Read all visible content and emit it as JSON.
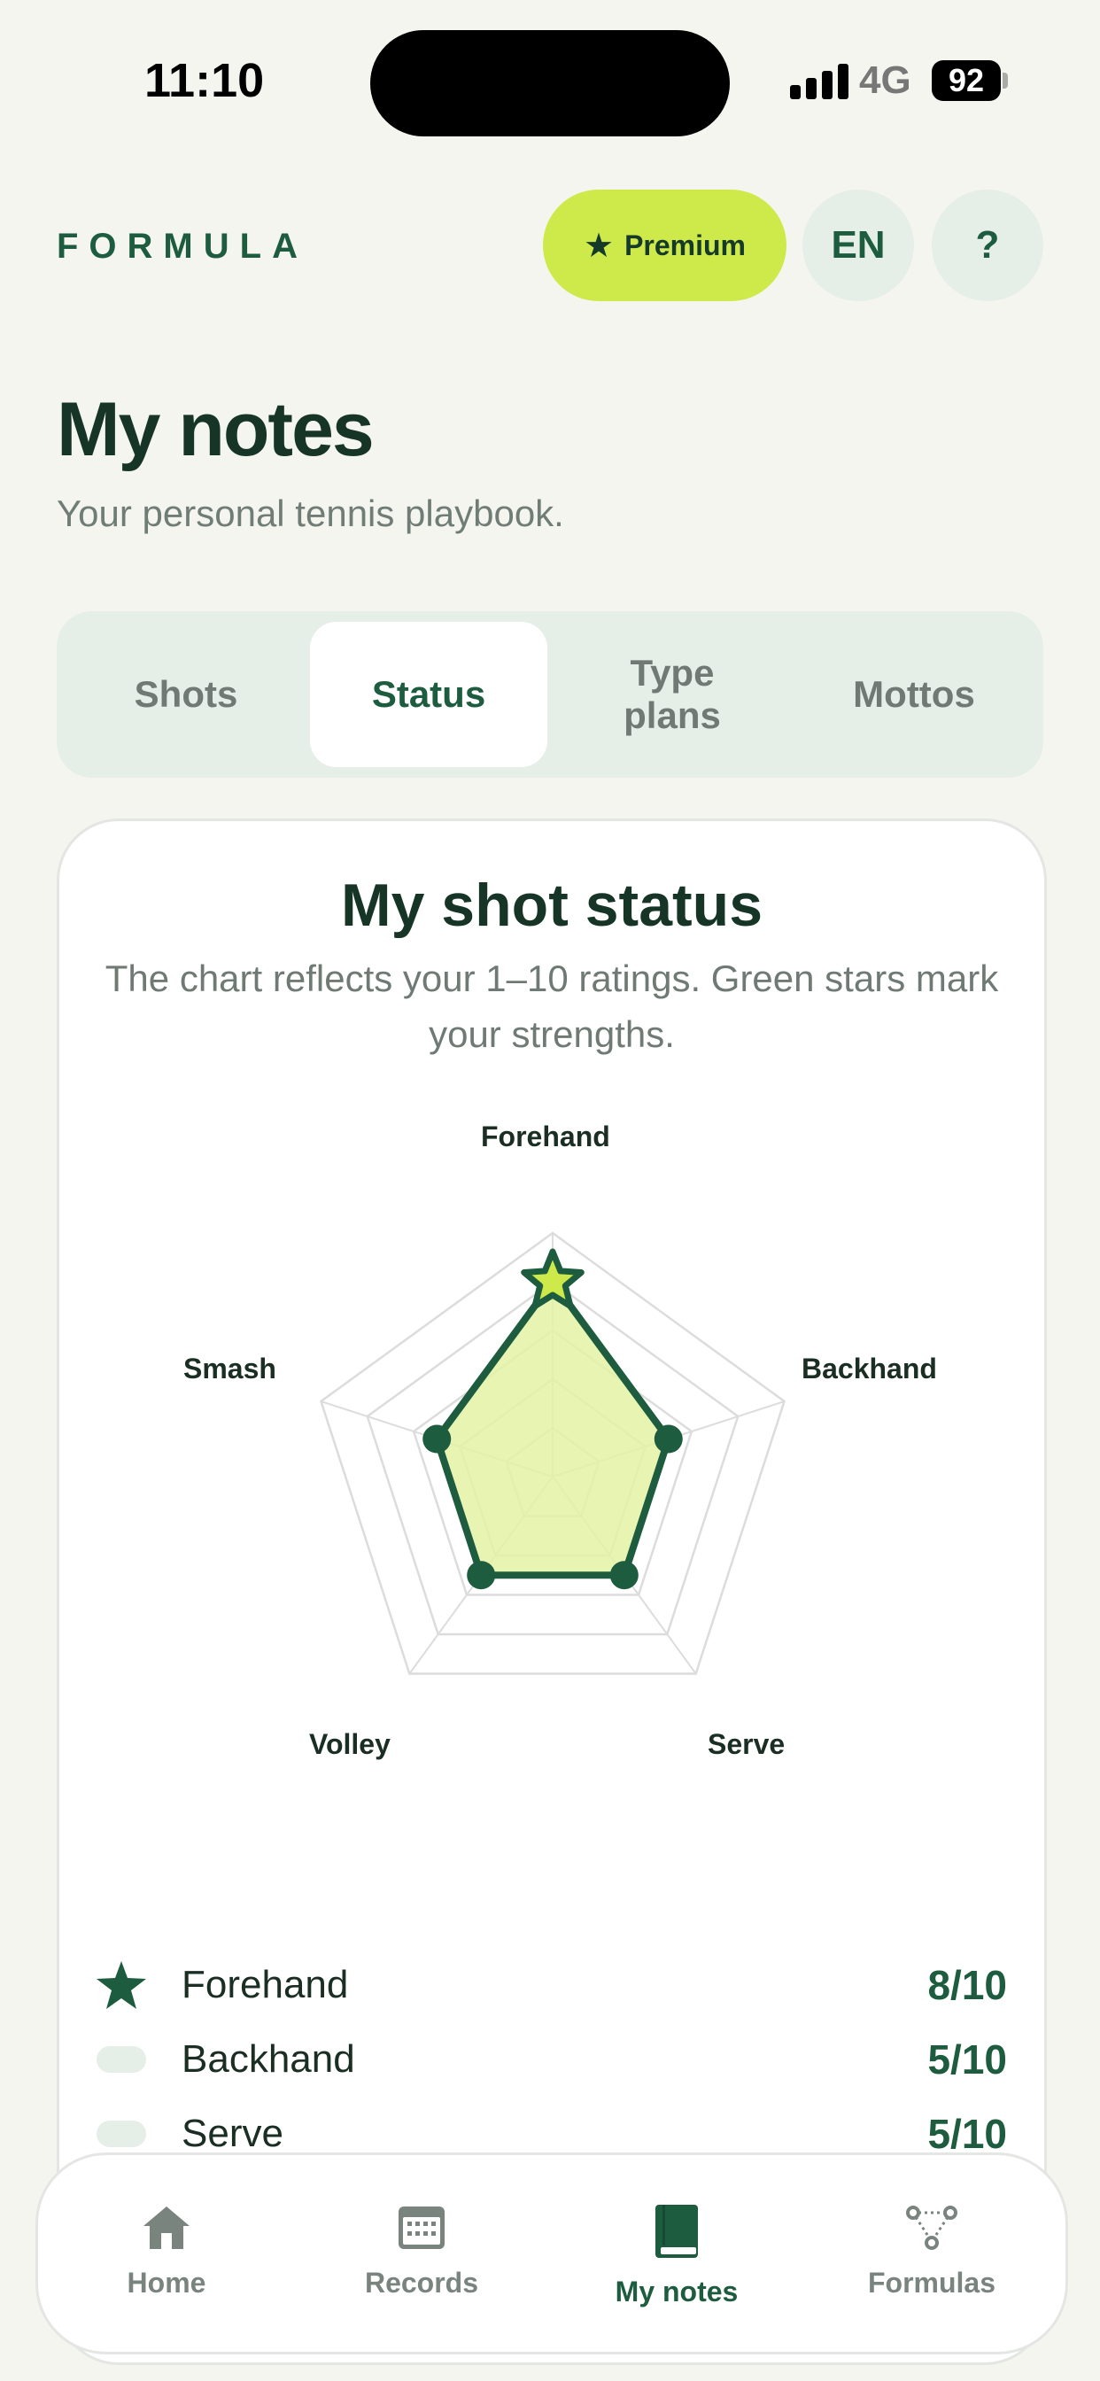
{
  "status_bar": {
    "time": "11:10",
    "network": "4G",
    "battery": "92"
  },
  "header": {
    "brand": "FORMULA",
    "premium_label": "Premium",
    "language": "EN",
    "help": "?"
  },
  "page": {
    "title": "My notes",
    "subtitle": "Your personal tennis playbook."
  },
  "tabs": [
    {
      "label": "Shots",
      "active": false
    },
    {
      "label": "Status",
      "active": true
    },
    {
      "label": "Type plans",
      "active": false
    },
    {
      "label": "Mottos",
      "active": false
    }
  ],
  "card": {
    "title": "My shot status",
    "description": "The chart reflects your 1–10 ratings. Green stars mark your strengths."
  },
  "chart_data": {
    "type": "radar",
    "title": "",
    "axes": [
      "Forehand",
      "Backhand",
      "Serve",
      "Volley",
      "Smash"
    ],
    "values": [
      8,
      5,
      5,
      5,
      5
    ],
    "max": 10,
    "strengths": [
      "Forehand"
    ],
    "colors": {
      "fill": "#e4f2a4",
      "stroke": "#1d5c3f",
      "star": "#cde94a",
      "grid": "#dcdcdc"
    }
  },
  "legend": [
    {
      "name": "Forehand",
      "value": "8/10",
      "icon": "star-icon"
    },
    {
      "name": "Backhand",
      "value": "5/10",
      "icon": "pill-icon"
    },
    {
      "name": "Serve",
      "value": "5/10",
      "icon": "pill-icon"
    }
  ],
  "nav": [
    {
      "label": "Home",
      "icon": "home-icon",
      "active": false
    },
    {
      "label": "Records",
      "icon": "calendar-icon",
      "active": false
    },
    {
      "label": "My notes",
      "icon": "book-icon",
      "active": true
    },
    {
      "label": "Formulas",
      "icon": "formula-nodes-icon",
      "active": false
    }
  ],
  "colors": {
    "accent": "#1d5c3f",
    "premium": "#cde94a",
    "background": "#f5f5f0"
  }
}
